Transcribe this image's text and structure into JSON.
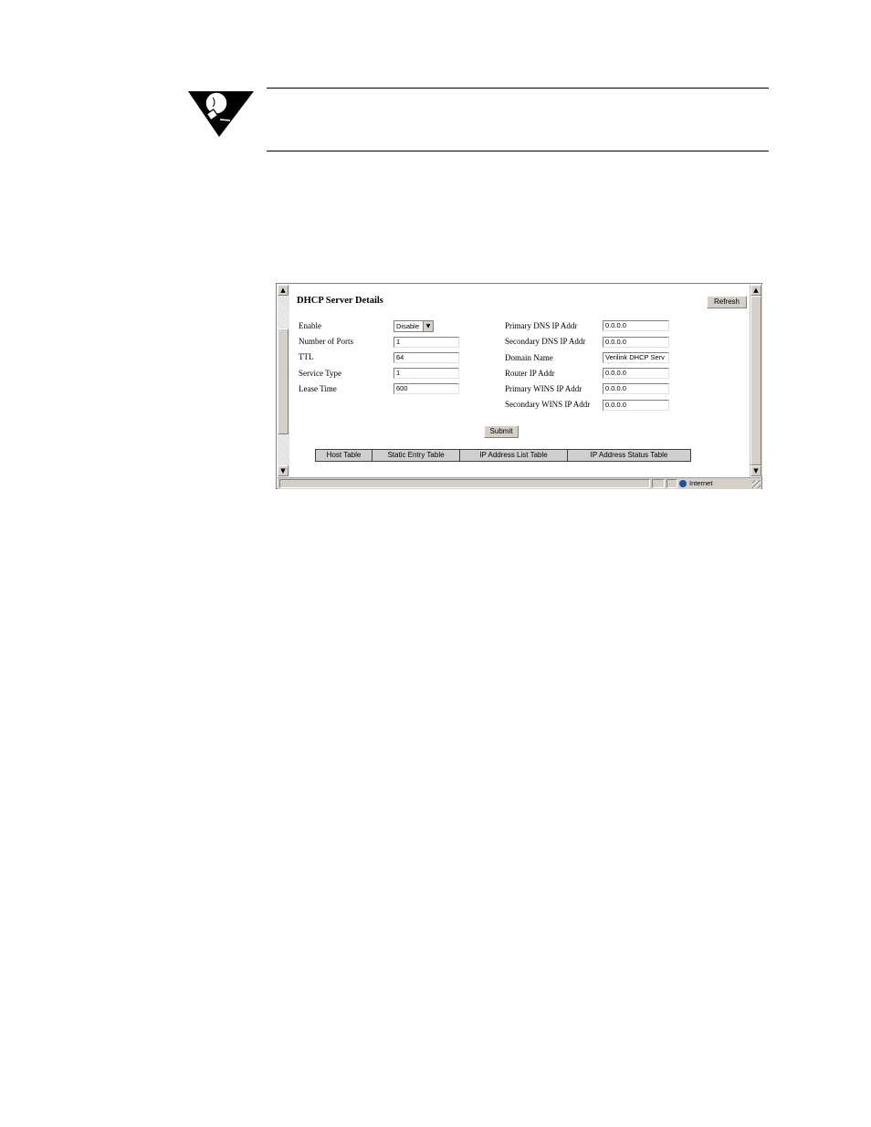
{
  "window": {
    "title": "DHCP Server Details",
    "refresh_label": "Refresh",
    "submit_label": "Submit"
  },
  "left_fields": [
    {
      "label": "Enable",
      "type": "select",
      "value": "Disable"
    },
    {
      "label": "Number of Ports",
      "type": "text",
      "value": "1"
    },
    {
      "label": "TTL",
      "type": "text",
      "value": "64"
    },
    {
      "label": "Service Type",
      "type": "text",
      "value": "1"
    },
    {
      "label": "Lease Time",
      "type": "text",
      "value": "600"
    }
  ],
  "right_fields": [
    {
      "label": "Primary DNS IP Addr",
      "value": "0.0.0.0"
    },
    {
      "label": "Secondary DNS IP Addr",
      "value": "0.0.0.0"
    },
    {
      "label": "Domain Name",
      "value": "Verilink DHCP Serv"
    },
    {
      "label": "Router IP Addr",
      "value": "0.0.0.0"
    },
    {
      "label": "Primary WINS IP Addr",
      "value": "0.0.0.0"
    },
    {
      "label": "Secondary WINS IP Addr",
      "value": "0.0.0.0"
    }
  ],
  "tabs": [
    "Host Table",
    "Static Entry Table",
    "IP Address List Table",
    "IP Address Status Table"
  ],
  "status_bar": {
    "zone": "Internet"
  },
  "icons": {
    "tip": "lightbulb-tip-icon",
    "zone": "globe-icon",
    "scroll_up": "▲",
    "scroll_down": "▼",
    "dropdown": "▼"
  }
}
